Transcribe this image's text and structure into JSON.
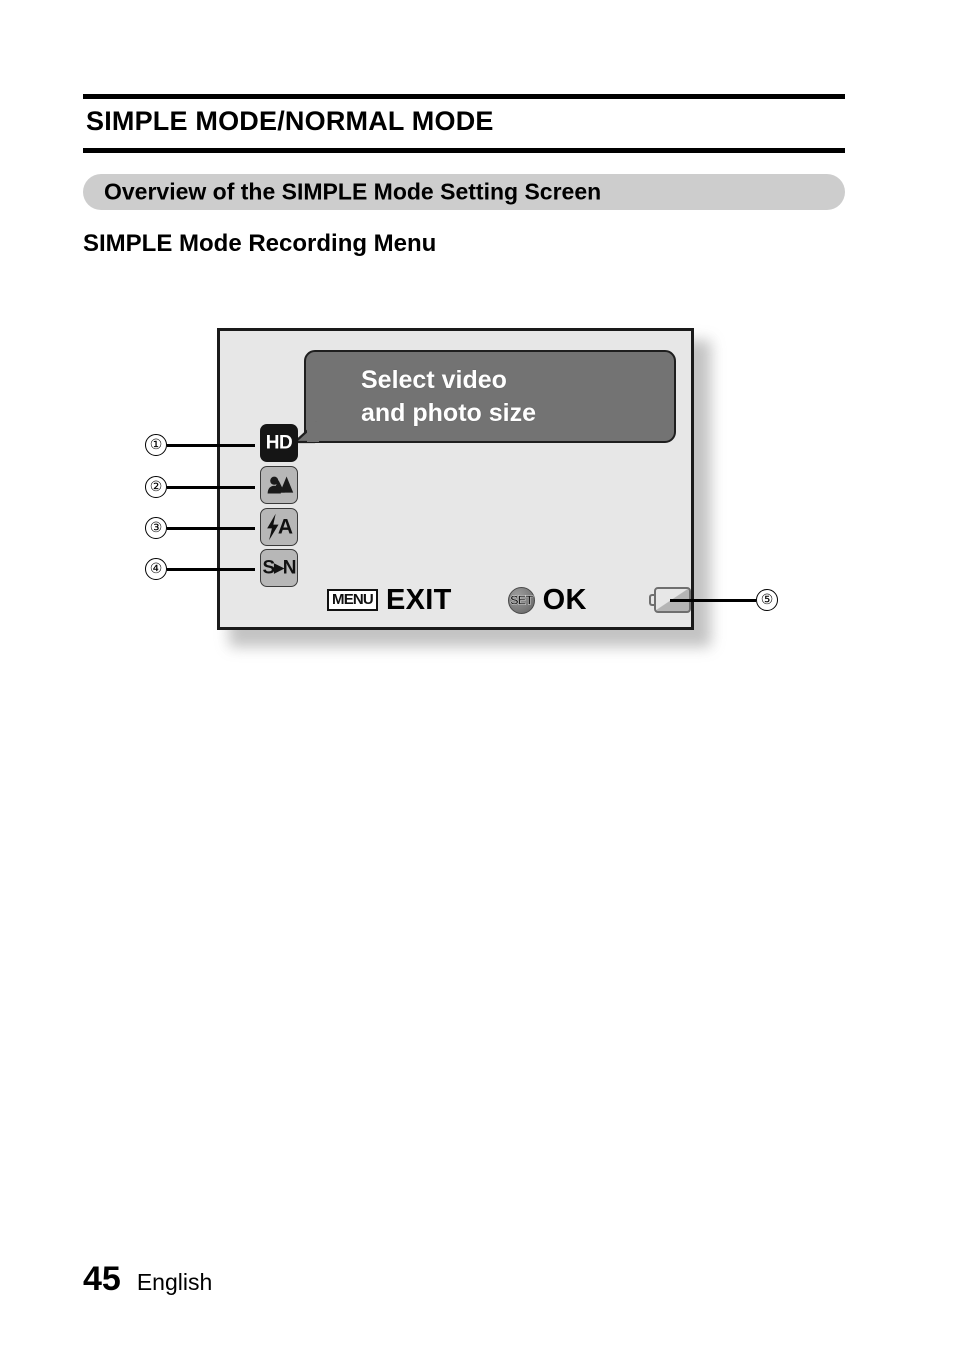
{
  "document": {
    "chapter_title": "SIMPLE MODE/NORMAL MODE",
    "section_band_label": "Overview of the SIMPLE Mode Setting Screen",
    "sub_heading": "SIMPLE Mode Recording Menu"
  },
  "screen": {
    "bubble_text": "Select video\nand photo size",
    "icons": [
      {
        "id": "video-photo-size",
        "label": "HD",
        "style": "black"
      },
      {
        "id": "scene-select",
        "label": "",
        "style": "gray"
      },
      {
        "id": "flash-auto",
        "label": "A",
        "style": "gray"
      },
      {
        "id": "simple-to-normal",
        "label": "S▸N",
        "style": "gray"
      }
    ],
    "bottom_bar": {
      "menu_chip": "MENU",
      "exit_label": "EXIT",
      "set_chip": "SET",
      "ok_label": "OK"
    },
    "battery_icon": "battery-indicator"
  },
  "callouts": {
    "one": "①",
    "two": "②",
    "three": "③",
    "four": "④",
    "five": "⑤"
  },
  "footer": {
    "page_number": "45",
    "language": "English"
  },
  "colors": {
    "band": "#cdcdcd",
    "lcd_background": "#e7e7e7",
    "bubble": "#737373",
    "icon_gray": "#b7b7b7",
    "icon_black": "#151515",
    "rule": "#000000"
  }
}
